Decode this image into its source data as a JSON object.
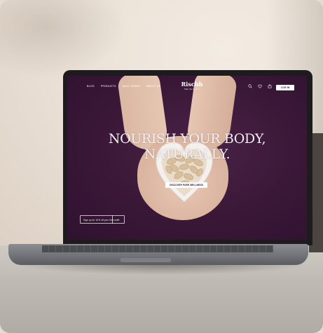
{
  "nav": {
    "links": [
      "BLOG",
      "PRODUCTS",
      "BULK ORDER",
      "ABOUT US"
    ],
    "login_label": "LOG IN",
    "icons": [
      "search-icon",
      "heart-icon",
      "bag-icon"
    ]
  },
  "brand": {
    "name": "Rischh",
    "tagline": "Take the Healthy"
  },
  "hero": {
    "headline_line1": "NOURISH YOUR BODY,",
    "headline_line2": "NATURALLY.",
    "cta_label": "DISCOVER PURE WELLNESS"
  },
  "signup": {
    "placeholder": "Sign up for 10% off your first order",
    "arrow": "→"
  },
  "colors": {
    "site_bg": "#3a1737",
    "text": "#f4eef4",
    "button_bg": "#ffffff"
  }
}
